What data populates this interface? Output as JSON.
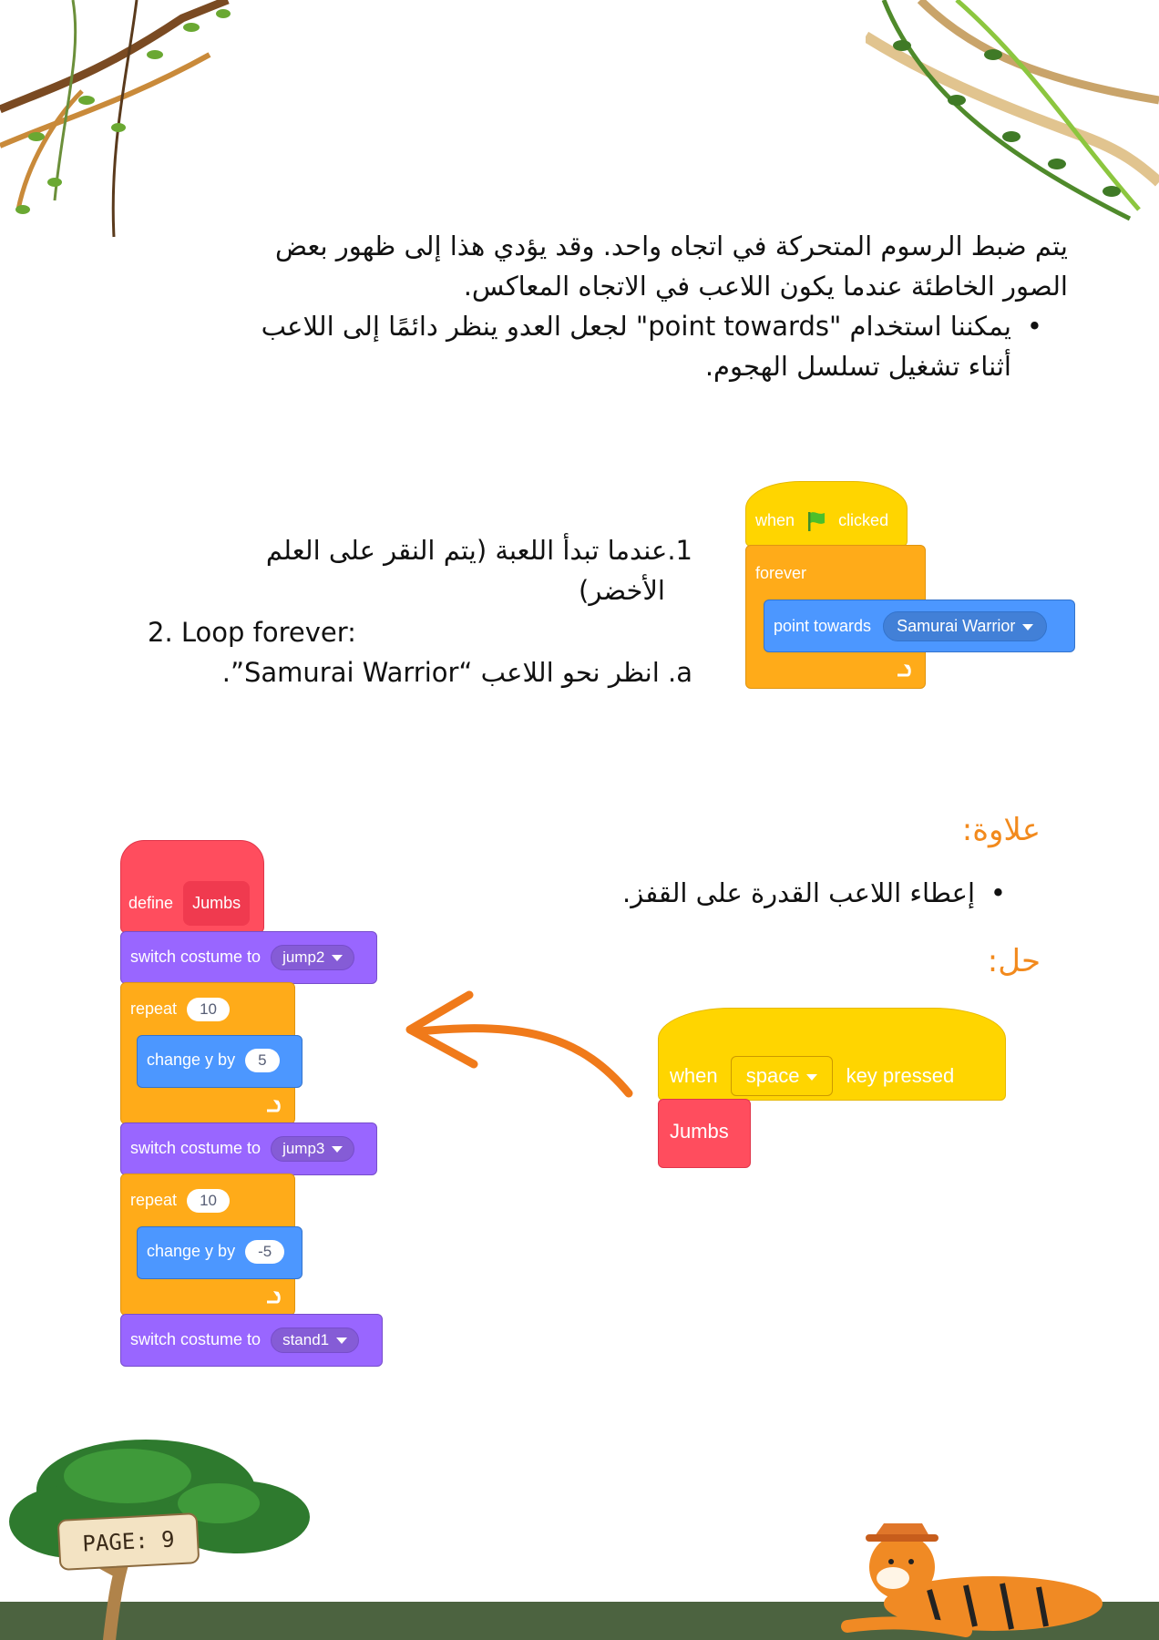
{
  "intro": {
    "line1": "يتم ضبط الرسوم المتحركة في اتجاه واحد. وقد يؤدي هذا إلى ظهور بعض",
    "line2": "الصور الخاطئة عندما يكون اللاعب في الاتجاه المعاكس.",
    "bullet1": "يمكننا استخدام \"point towards\" لجعل العدو ينظر دائمًا إلى اللاعب",
    "bullet2": "أثناء تشغيل تسلسل الهجوم."
  },
  "steps": {
    "step1_num": "1.",
    "step1_a": "عندما تبدأ اللعبة (يتم النقر على العلم",
    "step1_b": "الأخضر)",
    "step2": "2. Loop forever:",
    "step2a": "a. انظر نحو اللاعب “Samurai Warrior”."
  },
  "script1": {
    "when": "when",
    "clicked": "clicked",
    "forever": "forever",
    "point_towards": "point towards",
    "target": "Samurai Warrior"
  },
  "bonus": {
    "heading": "علاوة:",
    "bullet": "إعطاء اللاعب القدرة على القفز.",
    "solution": "حل:"
  },
  "script2": {
    "when": "when",
    "key": "space",
    "key_pressed": "key pressed",
    "call": "Jumbs"
  },
  "script3": {
    "define": "define",
    "name": "Jumbs",
    "switch_label": "switch costume to",
    "costume1": "jump2",
    "repeat_label": "repeat",
    "repeat1": "10",
    "change_label": "change y by",
    "change1": "5",
    "costume2": "jump3",
    "repeat2": "10",
    "change2": "-5",
    "costume3": "stand1"
  },
  "footer": {
    "page_label": "PAGE: 9"
  },
  "colors": {
    "accent_orange": "#f28a1d",
    "ground": "#4c6340",
    "events_yellow": "#ffd500",
    "control_orange": "#ffab19",
    "motion_blue": "#4c97ff",
    "looks_purple": "#9966ff",
    "custom_pink": "#ff6680"
  }
}
